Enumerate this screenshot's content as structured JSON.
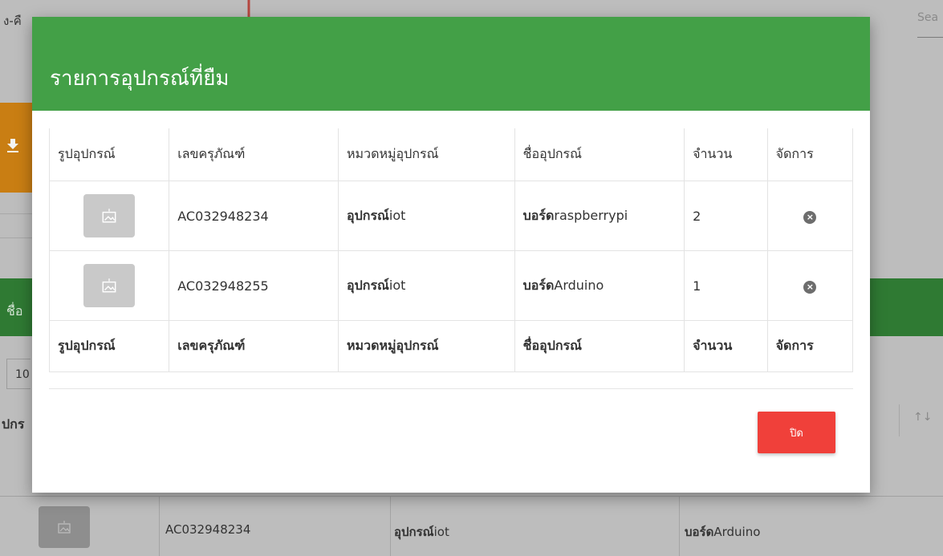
{
  "background": {
    "title": "ง-คื",
    "search_label": "Sea",
    "download_icon": "download-icon",
    "green_bar_text": "ชื่อ",
    "page_size": "10",
    "column_prefix": "ปกร",
    "sort_icon": "↑↓",
    "row": {
      "asset_no": "AC032948234",
      "category_bold": "อุปกรณ์",
      "category_rest": "iot",
      "name_bold": "บอร์ด",
      "name_rest": "Arduino"
    }
  },
  "modal": {
    "title": "รายการอุปกรณ์ที่ยืม",
    "columns": [
      "รูปอุปกรณ์",
      "เลขครุภัณฑ์",
      "หมวดหมู่อุปกรณ์",
      "ชื่ออุปกรณ์",
      "จำนวน",
      "จัดการ"
    ],
    "rows": [
      {
        "asset_no": "AC032948234",
        "category_bold": "อุปกรณ์",
        "category_rest": "iot",
        "name_bold": "บอร์ด",
        "name_rest": "raspberrypi",
        "qty": "2",
        "remove_icon": "×"
      },
      {
        "asset_no": "AC032948255",
        "category_bold": "อุปกรณ์",
        "category_rest": "iot",
        "name_bold": "บอร์ด",
        "name_rest": "Arduino",
        "qty": "1",
        "remove_icon": "×"
      }
    ],
    "close_label": "ปิด"
  },
  "colors": {
    "header_green": "#43a047",
    "close_red": "#f0403a",
    "arrow": "#b5473f"
  }
}
